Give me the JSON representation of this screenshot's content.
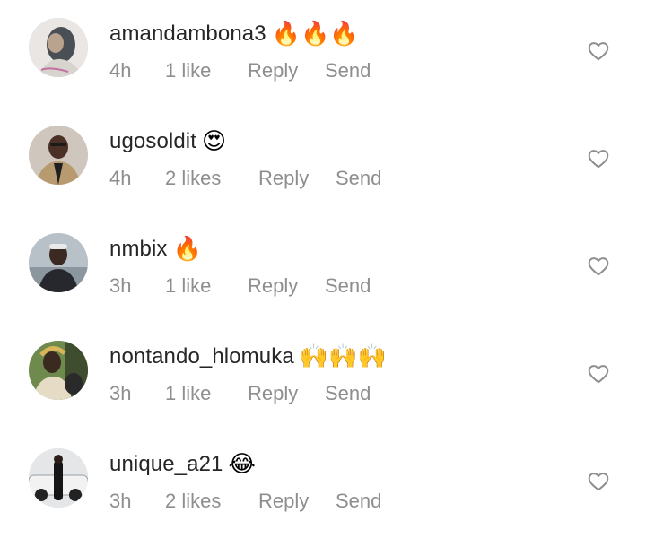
{
  "comments": [
    {
      "username": "amandambona3",
      "emoji": "🔥🔥🔥",
      "time": "4h",
      "likes": "1 like",
      "reply": "Reply",
      "send": "Send",
      "avatar_colors": [
        "#8a9099",
        "#e8e4e0"
      ]
    },
    {
      "username": "ugosoldit",
      "emoji": "😍",
      "time": "4h",
      "likes": "2 likes",
      "reply": "Reply",
      "send": "Send",
      "avatar_colors": [
        "#8b7b62",
        "#3a2d25"
      ]
    },
    {
      "username": "nmbix",
      "emoji": "🔥",
      "time": "3h",
      "likes": "1 like",
      "reply": "Reply",
      "send": "Send",
      "avatar_colors": [
        "#9aa4ad",
        "#2b2d33"
      ]
    },
    {
      "username": "nontando_hlomuka",
      "emoji": "🙌🙌🙌",
      "time": "3h",
      "likes": "1 like",
      "reply": "Reply",
      "send": "Send",
      "avatar_colors": [
        "#6f8a4e",
        "#d9c9a7"
      ]
    },
    {
      "username": "unique_a21",
      "emoji": "😂",
      "time": "3h",
      "likes": "2 likes",
      "reply": "Reply",
      "send": "Send",
      "avatar_colors": [
        "#d9dcdf",
        "#202020"
      ]
    }
  ],
  "colors": {
    "username": "#262626",
    "meta": "#8e8e8e",
    "heart_outline": "#8e8e8e"
  },
  "icons": {
    "like": "heart-outline-icon"
  }
}
